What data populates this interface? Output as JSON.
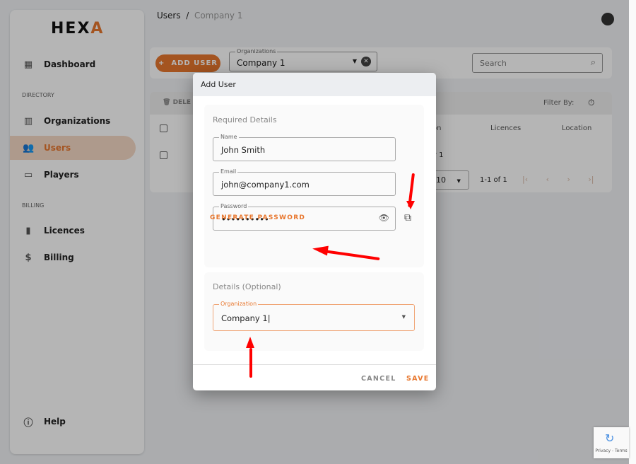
{
  "brand": {
    "logo": "HEXA",
    "accent": "#e8772e"
  },
  "breadcrumb": {
    "root": "Users",
    "separator": "/",
    "current": "Company 1"
  },
  "sidebar": {
    "items": [
      {
        "label": "Dashboard",
        "icon": "dashboard-icon"
      }
    ],
    "directory_label": "DIRECTORY",
    "directory": [
      {
        "label": "Organizations",
        "icon": "building-icon"
      },
      {
        "label": "Users",
        "icon": "users-icon",
        "active": true
      },
      {
        "label": "Players",
        "icon": "monitor-icon"
      }
    ],
    "billing_label": "BILLING",
    "billing": [
      {
        "label": "Licences",
        "icon": "licence-icon"
      },
      {
        "label": "Billing",
        "icon": "dollar-icon"
      }
    ],
    "help": "Help"
  },
  "toolbar": {
    "add_user": "ADD USER",
    "org_label": "Organizations",
    "org_value": "Company 1",
    "search_placeholder": "Search"
  },
  "table": {
    "delete": "DELE",
    "filter_by": "Filter By:",
    "columns": [
      "on",
      "Licences",
      "Location"
    ],
    "row_fragment": "y 1",
    "rows_per_page": "10",
    "range": "1-1 of 1"
  },
  "dialog": {
    "title": "Add User",
    "required_title": "Required Details",
    "name_label": "Name",
    "name_value": "John Smith",
    "email_label": "Email",
    "email_value": "john@company1.com",
    "password_label": "Password",
    "password_value": "••••••••••",
    "generate": "GENERATE PASSWORD",
    "optional_title": "Details (Optional)",
    "org_label": "Organization",
    "org_value": "Company 1",
    "cancel": "CANCEL",
    "save": "SAVE"
  },
  "recaptcha": "Privacy - Terms"
}
